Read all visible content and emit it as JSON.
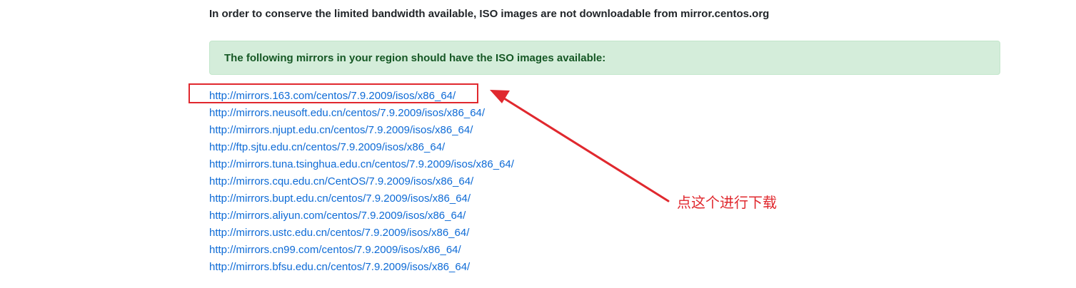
{
  "notice": "In order to conserve the limited bandwidth available, ISO images are not downloadable from mirror.centos.org",
  "alert": "The following mirrors in your region should have the ISO images available:",
  "mirrors": [
    "http://mirrors.163.com/centos/7.9.2009/isos/x86_64/",
    "http://mirrors.neusoft.edu.cn/centos/7.9.2009/isos/x86_64/",
    "http://mirrors.njupt.edu.cn/centos/7.9.2009/isos/x86_64/",
    "http://ftp.sjtu.edu.cn/centos/7.9.2009/isos/x86_64/",
    "http://mirrors.tuna.tsinghua.edu.cn/centos/7.9.2009/isos/x86_64/",
    "http://mirrors.cqu.edu.cn/CentOS/7.9.2009/isos/x86_64/",
    "http://mirrors.bupt.edu.cn/centos/7.9.2009/isos/x86_64/",
    "http://mirrors.aliyun.com/centos/7.9.2009/isos/x86_64/",
    "http://mirrors.ustc.edu.cn/centos/7.9.2009/isos/x86_64/",
    "http://mirrors.cn99.com/centos/7.9.2009/isos/x86_64/",
    "http://mirrors.bfsu.edu.cn/centos/7.9.2009/isos/x86_64/"
  ],
  "annotation": {
    "text": "点这个进行下载",
    "color": "#e0282e"
  },
  "colors": {
    "link": "#0e6bd6",
    "alert_bg": "#d4edda",
    "alert_text": "#155724"
  }
}
